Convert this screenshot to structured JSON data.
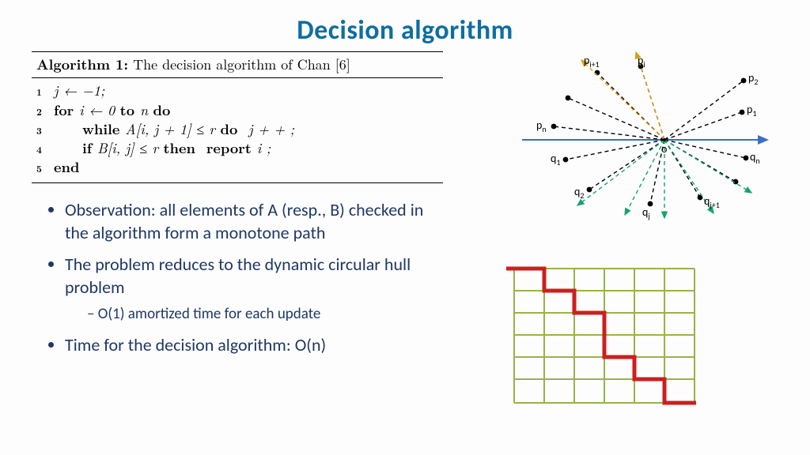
{
  "title": "Decision algorithm",
  "algorithm": {
    "label": "Algorithm 1:",
    "caption": "The decision algorithm of Chan [6]",
    "lines": {
      "l1": "j ← −1;",
      "l2_a": "for ",
      "l2_b": "i ← 0 ",
      "l2_c": "to ",
      "l2_d": "n ",
      "l2_e": "do",
      "l3_a": "while ",
      "l3_b": "A[i, j + 1] ≤ r ",
      "l3_c": "do  ",
      "l3_d": "j + + ;",
      "l4_a": "if ",
      "l4_b": "B[i, j] ≤ r ",
      "l4_c": "then  report ",
      "l4_d": "i ;",
      "l5": "end"
    }
  },
  "bullets": {
    "b1": "Observation: all elements of A (resp., B) checked in the algorithm form a monotone path",
    "b2": "The problem reduces to the dynamic circular hull problem",
    "b2_sub": "O(1) amortized time for each update",
    "b3": "Time for the decision algorithm: O(n)"
  },
  "ray_labels": {
    "p_i1": "p",
    "p_i1_sub": "i+1",
    "p_i": "p",
    "p_i_sub": "i",
    "p_2": "p",
    "p_2_sub": "2",
    "p_1": "p",
    "p_1_sub": "1",
    "p_n": "p",
    "p_n_sub": "n",
    "q_1": "q",
    "q_1_sub": "1",
    "q_2": "q",
    "q_2_sub": "2",
    "q_j": "q",
    "q_j_sub": "j",
    "q_j1": "q",
    "q_j1_sub": "j+1",
    "q_n": "q",
    "q_n_sub": "n",
    "origin": "o"
  },
  "colors": {
    "title": "#0f6ea0",
    "body_text": "#1f3864",
    "grid": "#9ab24a",
    "path": "#cc1f1f",
    "ray_green": "#15a36c",
    "ray_gold": "#d4a017",
    "axis_blue": "#3a6fc4"
  }
}
